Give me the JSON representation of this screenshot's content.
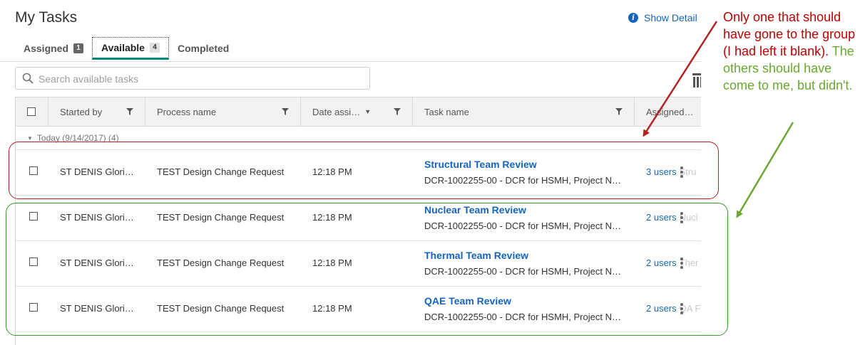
{
  "header": {
    "title": "My Tasks",
    "show_details": "Show Detail"
  },
  "tabs": [
    {
      "label": "Assigned",
      "count": "1"
    },
    {
      "label": "Available",
      "count": "4"
    },
    {
      "label": "Completed",
      "count": ""
    }
  ],
  "search": {
    "placeholder": "Search available tasks",
    "value": ""
  },
  "columns": {
    "started_by": "Started by",
    "process_name": "Process name",
    "date_assigned": "Date assi…",
    "task_name": "Task name",
    "assigned": "Assigned…"
  },
  "group": {
    "label": "Today (9/14/2017) (4)"
  },
  "rows": [
    {
      "started_by": "ST DENIS Glori…",
      "process": "TEST Design Change Request",
      "date": "12:18 PM",
      "task_name": "Structural Team Review",
      "task_desc": "DCR-1002255-00 - DCR for HSMH, Project N…",
      "assigned": "3 users",
      "assigned_extra": "Stru"
    },
    {
      "started_by": "ST DENIS Glori…",
      "process": "TEST Design Change Request",
      "date": "12:18 PM",
      "task_name": "Nuclear Team Review",
      "task_desc": "DCR-1002255-00 - DCR for HSMH, Project N…",
      "assigned": "2 users",
      "assigned_extra": "Nucl"
    },
    {
      "started_by": "ST DENIS Glori…",
      "process": "TEST Design Change Request",
      "date": "12:18 PM",
      "task_name": "Thermal Team Review",
      "task_desc": "DCR-1002255-00 - DCR for HSMH, Project N…",
      "assigned": "2 users",
      "assigned_extra": "Ther"
    },
    {
      "started_by": "ST DENIS Glori…",
      "process": "TEST Design Change Request",
      "date": "12:18 PM",
      "task_name": "QAE Team Review",
      "task_desc": "DCR-1002255-00 - DCR for HSMH, Project N…",
      "assigned": "2 users",
      "assigned_extra": "QA F"
    }
  ],
  "annotation": {
    "red_text": "Only one that should have gone to the group (I had left it blank).",
    "green_text": "The others should have come to me, but didn't."
  },
  "colors": {
    "link": "#1565c0",
    "active_tab_underline": "#00897b",
    "annotation_red": "#c00000",
    "annotation_green": "#6aa832"
  }
}
